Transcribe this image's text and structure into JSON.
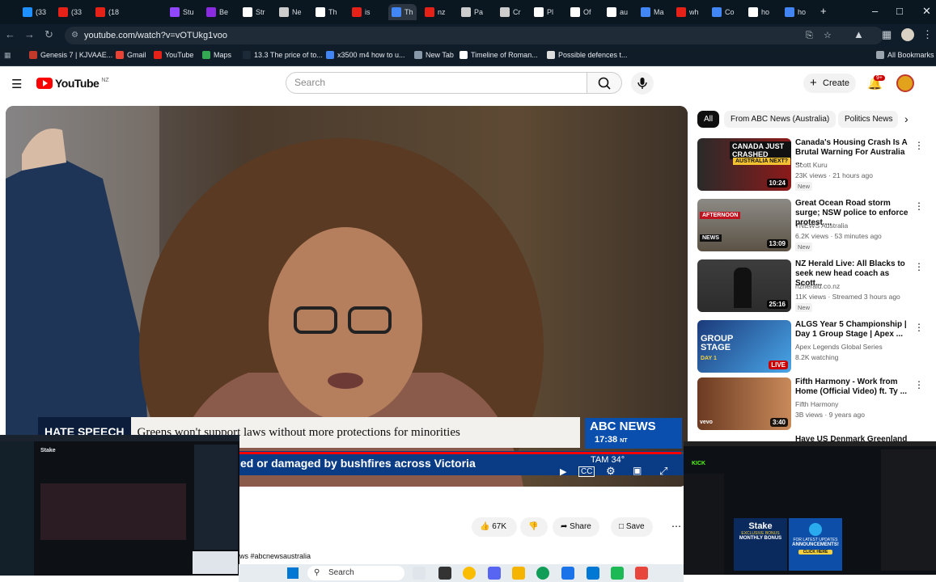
{
  "browser": {
    "tabs": [
      "(33",
      "(33",
      "(18",
      "Stu",
      "Be",
      "Str",
      "Ne",
      "Th",
      "is",
      "Th",
      "nz",
      "Pa",
      "Cr",
      "Pl",
      "Of",
      "au",
      "Ma",
      "wh",
      "Co",
      "ho"
    ],
    "url": "youtube.com/watch?v=vOTUkg1voo",
    "bookmarks": [
      "Genesis 7 | KJVAAE...",
      "Gmail",
      "YouTube",
      "Maps",
      "13.3 The price of to...",
      "x3500 m4 how to u...",
      "New Tab",
      "Timeline of Roman...",
      "Possible defences t..."
    ],
    "all_bookmarks": "All Bookmarks"
  },
  "youtube": {
    "logo": "YouTube",
    "region": "NZ",
    "search_placeholder": "Search",
    "create_label": "Create",
    "notif_count": "9+"
  },
  "video": {
    "lower_third_tag": "HATE SPEECH",
    "headline": "Greens won't support laws without more protections for minorities",
    "ticker": "ed or damaged by bushfires across Victoria",
    "network": "ABC NEWS",
    "time": "17:38",
    "tz": "NT",
    "weather_city": "TAM",
    "temp": "34°"
  },
  "actions": {
    "likes": "67K",
    "share": "Share",
    "save": "Save"
  },
  "description_hashtag": "ws #abcnewsaustralia",
  "chips": [
    "All",
    "From ABC News (Australia)",
    "Politics News"
  ],
  "recommendations": [
    {
      "title": "Canada's Housing Crash Is A Brutal Warning For Australia ...",
      "channel": "Scott Kuru",
      "meta": "23K views · 21 hours ago",
      "badge": "New",
      "duration": "10:24",
      "thumb_text": "CANADA JUST CRASHED",
      "thumb_sub": "AUSTRALIA NEXT?"
    },
    {
      "title": "Great Ocean Road storm surge; NSW police to enforce protest ...",
      "channel": "7NEWS Australia",
      "meta": "6.2K views · 53 minutes ago",
      "badge": "New",
      "duration": "13:09",
      "thumb_text": "AFTERNOON",
      "thumb_sub": "NEWS"
    },
    {
      "title": "NZ Herald Live: All Blacks to seek new head coach as Scott...",
      "channel": "nzherald.co.nz",
      "meta": "11K views · Streamed 3 hours ago",
      "badge": "New",
      "duration": "25:16",
      "thumb_text": "",
      "thumb_sub": ""
    },
    {
      "title": "ALGS Year 5 Championship | Day 1 Group Stage | Apex ...",
      "channel": "Apex Legends Global Series",
      "meta": "8.2K watching",
      "badge": "",
      "duration": "LIVE",
      "thumb_text": "GROUP STAGE",
      "thumb_sub": "DAY 1"
    },
    {
      "title": "Fifth Harmony - Work from Home (Official Video) ft. Ty ...",
      "channel": "Fifth Harmony",
      "meta": "3B views · 9 years ago",
      "badge": "",
      "duration": "3:40",
      "thumb_text": "vevo",
      "thumb_sub": ""
    },
    {
      "title": "Have US Denmark Greenland",
      "channel": "",
      "meta": "",
      "badge": "",
      "duration": "",
      "thumb_text": "",
      "thumb_sub": ""
    }
  ],
  "overlay_right": {
    "brand": "KICK",
    "ad1_title": "Stake",
    "ad1_line1": "EXCLUSIVE BONUS",
    "ad1_line2": "MONTHLY BONUS",
    "ad2_line1": "FOR LATEST UPDATES",
    "ad2_line2": "ANNOUNCEMENTS!",
    "ad2_cta": "CLICK HERE"
  },
  "overlay_left": {
    "brand": "Stake"
  },
  "taskbar": {
    "search": "Search"
  }
}
